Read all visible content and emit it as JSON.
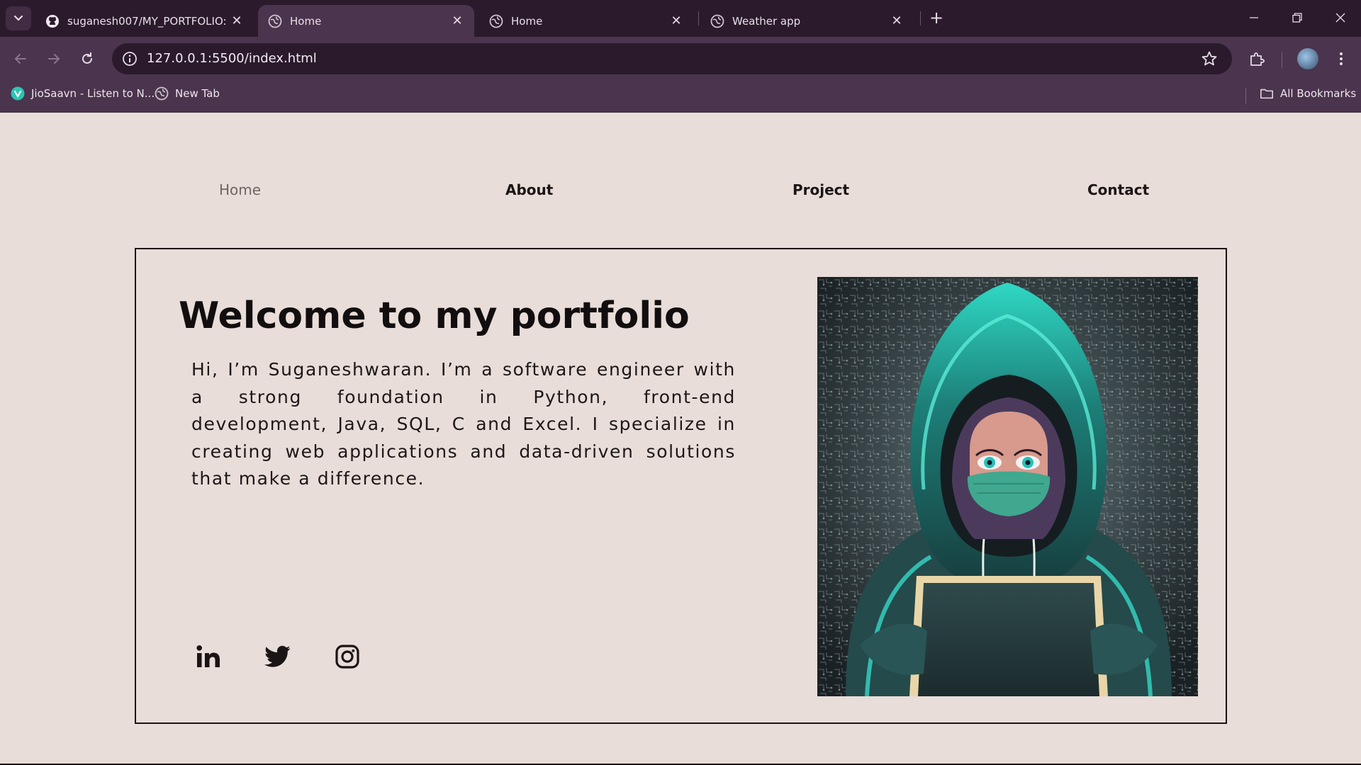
{
  "browser": {
    "tabs": [
      {
        "title": "suganesh007/MY_PORTFOLIO: 💻",
        "favicon": "github-icon"
      },
      {
        "title": "Home",
        "favicon": "globe-icon"
      },
      {
        "title": "Home",
        "favicon": "globe-icon"
      },
      {
        "title": "Weather app",
        "favicon": "globe-icon"
      }
    ],
    "url": "127.0.0.1:5500/index.html",
    "bookmarks": [
      {
        "label": "JioSaavn - Listen to N...",
        "icon": "jiosaavn-icon"
      },
      {
        "label": "New Tab",
        "icon": "globe-icon"
      }
    ],
    "all_bookmarks_label": "All Bookmarks"
  },
  "nav": {
    "home": "Home",
    "about": "About",
    "project": "Project",
    "contact": "Contact"
  },
  "hero": {
    "title": "Welcome to my portfolio",
    "intro": "Hi, I’m Suganeshwaran. I’m a software engineer with a strong foundation in Python, front-end development, Java, SQL, C and Excel. I specialize in creating web applications and data-driven solutions that make a difference."
  },
  "social": [
    "linkedin-icon",
    "twitter-icon",
    "instagram-icon"
  ],
  "colors": {
    "page_bg": "#e8ddd8",
    "text": "#120e0f",
    "chrome_dark": "#2b1a2c",
    "chrome_mid": "#4b344d",
    "accent_teal": "#2fd8c4"
  }
}
